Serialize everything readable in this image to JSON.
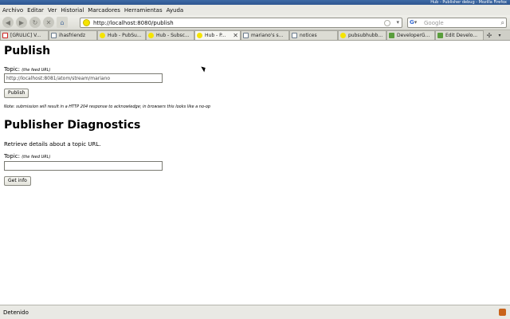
{
  "window": {
    "title": "Hub - Publisher debug - Mozilla Firefox"
  },
  "menu": [
    "Archivo",
    "Editar",
    "Ver",
    "Historial",
    "Marcadores",
    "Herramientas",
    "Ayuda"
  ],
  "nav": {
    "url": "http://localhost:8080/publish",
    "search_placeholder": "Google"
  },
  "tabs": [
    {
      "label": "[GRULIC] V...",
      "icon": "gmail-icon",
      "active": false
    },
    {
      "label": "ihasfriendz",
      "icon": "page-icon",
      "active": false
    },
    {
      "label": "Hub - PubSu...",
      "icon": "yellow-dot-icon",
      "active": false
    },
    {
      "label": "Hub - Subsc...",
      "icon": "yellow-dot-icon",
      "active": false
    },
    {
      "label": "Hub - P...",
      "icon": "yellow-dot-icon",
      "active": true
    },
    {
      "label": "mariano's s...",
      "icon": "page-icon",
      "active": false
    },
    {
      "label": "notices",
      "icon": "page-icon",
      "active": false
    },
    {
      "label": "pubsubhubb...",
      "icon": "yellow-dot-icon",
      "active": false
    },
    {
      "label": "DeveloperG...",
      "icon": "puzzle-icon",
      "active": false
    },
    {
      "label": "Edit Develo...",
      "icon": "puzzle-icon",
      "active": false
    }
  ],
  "publish": {
    "heading": "Publish",
    "topic_label": "Topic:",
    "topic_hint": "(the feed URL)",
    "topic_value": "http://localhost:8081/atom/stream/mariano",
    "button": "Publish",
    "note": "Note: submission will result in a HTTP 204 response to acknowledge; in browsers this looks like a no-op"
  },
  "diagnostics": {
    "heading": "Publisher Diagnostics",
    "description": "Retrieve details about a topic URL.",
    "topic_label": "Topic:",
    "topic_hint": "(the feed URL)",
    "topic_value": "",
    "button": "Get info"
  },
  "status": {
    "text": "Detenido"
  }
}
